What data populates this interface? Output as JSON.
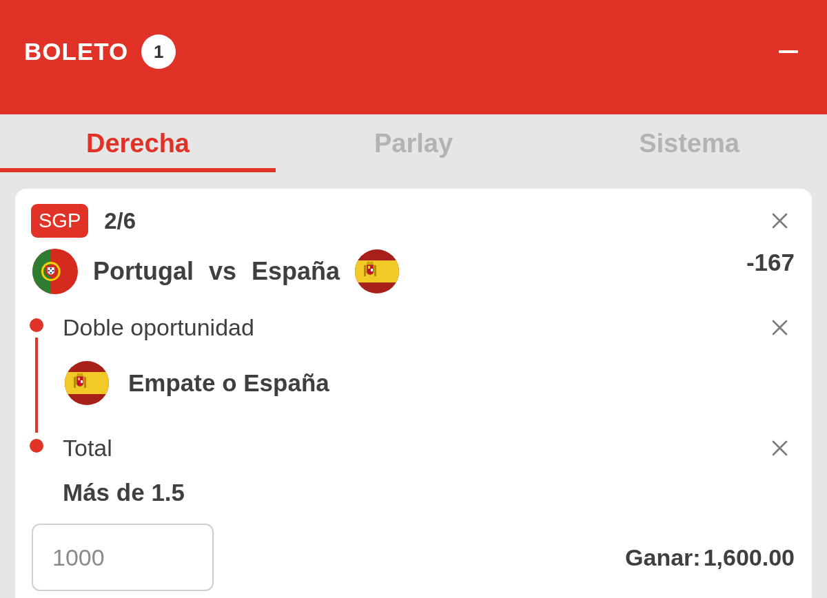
{
  "header": {
    "title": "BOLETO",
    "count": "1"
  },
  "tabs": [
    {
      "label": "Derecha",
      "selected": true
    },
    {
      "label": "Parlay",
      "selected": false
    },
    {
      "label": "Sistema",
      "selected": false
    }
  ],
  "bet": {
    "badge": "SGP",
    "legs": "2/6",
    "match": {
      "home": "Portugal",
      "separator": "vs",
      "away": "España"
    },
    "odds": "-167",
    "selections": [
      {
        "kind": "team",
        "market": "Doble oportunidad",
        "pick": "Empate o España"
      },
      {
        "kind": "total",
        "market": "Total",
        "pick": "Más de 1.5"
      }
    ],
    "stake": {
      "placeholder": "1000"
    },
    "payout": {
      "label": "Ganar:",
      "value": "1,600.00"
    }
  }
}
